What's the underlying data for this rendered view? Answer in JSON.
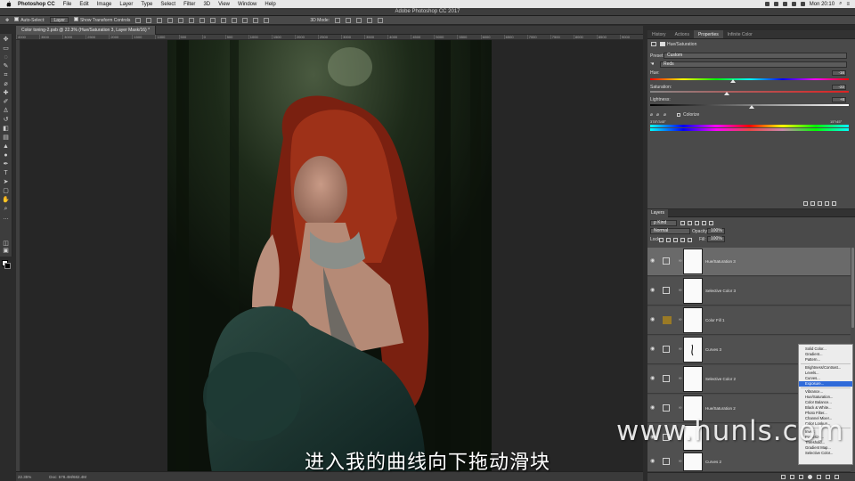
{
  "menubar": {
    "app_name": "Photoshop CC",
    "items": [
      "File",
      "Edit",
      "Image",
      "Layer",
      "Type",
      "Select",
      "Filter",
      "3D",
      "View",
      "Window",
      "Help"
    ],
    "clock": "Mon 20:10"
  },
  "window_title": "Adobe Photoshop CC 2017",
  "options_bar": {
    "auto_select_label": "Auto-Select:",
    "auto_select_value": "Layer",
    "show_transform_label": "Show Transform Controls",
    "mode_3d_label": "3D Mode:"
  },
  "document_tab": "Color toning-2.psb @ 22.3% (Hue/Saturation 3, Layer Mask/16) *",
  "ruler_ticks": [
    "4000",
    "3500",
    "3000",
    "2500",
    "2000",
    "1500",
    "1000",
    "500",
    "0",
    "500",
    "1000",
    "1500",
    "2000",
    "2500",
    "3000",
    "3500",
    "4000",
    "4500",
    "5000",
    "5500",
    "6000",
    "6500",
    "7000",
    "7500",
    "8000",
    "8500",
    "9000"
  ],
  "status_bar": {
    "zoom": "22.35%",
    "doc_size": "Doc: 578.4M/682.4M"
  },
  "panel_tabs": [
    "History",
    "Actions",
    "Properties",
    "Infinite Color"
  ],
  "properties": {
    "title": "Hue/Saturation",
    "preset_label": "Preset:",
    "preset_value": "Custom",
    "channel_value": "Reds",
    "hue_label": "Hue:",
    "hue_value": "-16",
    "saturation_label": "Saturation:",
    "saturation_value": "-22",
    "lightness_label": "Lightness:",
    "lightness_value": "+8",
    "colorize_label": "Colorize",
    "range_left": "378°/345°",
    "range_right": "15°\\45°"
  },
  "layers": {
    "tab_label": "Layers",
    "kind_label": "ρ Kind",
    "blend_mode": "Normal",
    "opacity_label": "Opacity:",
    "opacity_value": "100%",
    "lock_label": "Lock:",
    "fill_label": "Fill:",
    "fill_value": "100%",
    "items": [
      {
        "name": "Hue/Saturation 3",
        "icon": "hue-saturation-icon",
        "selected": true
      },
      {
        "name": "Selective Color 3",
        "icon": "selective-color-icon",
        "selected": false
      },
      {
        "name": "Color Fill 1",
        "icon": "color-fill-icon",
        "selected": false,
        "swatch": "#9a7a26"
      },
      {
        "name": "Curves 3",
        "icon": "curves-icon",
        "selected": false
      },
      {
        "name": "Selective Color 2",
        "icon": "selective-color-icon",
        "selected": false
      },
      {
        "name": "Hue/Saturation 2",
        "icon": "hue-saturation-icon",
        "selected": false
      },
      {
        "name": "",
        "icon": "curves-icon",
        "selected": false
      },
      {
        "name": "Curves 2",
        "icon": "curves-icon",
        "selected": false
      }
    ]
  },
  "adjustment_menu": {
    "items": [
      "Solid Color...",
      "Gradient...",
      "Pattern...",
      "---",
      "Brightness/Contrast...",
      "Levels...",
      "Curves...",
      "Exposure...",
      "---",
      "Vibrance...",
      "Hue/Saturation...",
      "Color Balance...",
      "Black & White...",
      "Photo Filter...",
      "Channel Mixer...",
      "Color Lookup...",
      "---",
      "Invert",
      "Posterize...",
      "Threshold...",
      "Gradient Map...",
      "Selective Color..."
    ],
    "highlighted": "Exposure..."
  },
  "subtitle": "进入我的曲线向下拖动滑块",
  "watermark": "www.hunls.com",
  "colors": {
    "accent": "#2f6ad9",
    "panel_bg": "#4a4a4a",
    "canvas_bg": "#262626"
  }
}
